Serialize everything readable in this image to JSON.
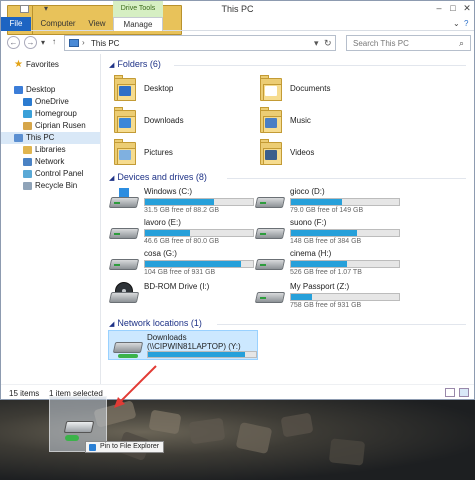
{
  "window": {
    "title": "This PC",
    "tabs": {
      "file": "File",
      "computer": "Computer",
      "view": "View",
      "drive_tools": "Drive Tools",
      "manage": "Manage"
    },
    "address": {
      "separator": "›",
      "path": "This PC"
    },
    "search": {
      "placeholder": "Search This PC"
    }
  },
  "sidebar": {
    "favorites": "Favorites",
    "items": [
      {
        "label": "Desktop",
        "icon": "desktop-icon",
        "color": "#3b7dd8"
      },
      {
        "label": "OneDrive",
        "icon": "onedrive-icon",
        "color": "#2b7bd0"
      },
      {
        "label": "Homegroup",
        "icon": "homegroup-icon",
        "color": "#3aa0d8"
      },
      {
        "label": "Ciprian Rusen",
        "icon": "user-icon",
        "color": "#d6a64a"
      },
      {
        "label": "This PC",
        "icon": "computer-icon",
        "color": "#5b8fd1"
      },
      {
        "label": "Libraries",
        "icon": "library-icon",
        "color": "#e0b54f"
      },
      {
        "label": "Network",
        "icon": "network-icon",
        "color": "#4a82c4"
      },
      {
        "label": "Control Panel",
        "icon": "control-panel-icon",
        "color": "#5aa9d6"
      },
      {
        "label": "Recycle Bin",
        "icon": "recycle-bin-icon",
        "color": "#8fa3b8"
      }
    ]
  },
  "groups": {
    "folders": "Folders (6)",
    "devices": "Devices and drives (8)",
    "network": "Network locations (1)"
  },
  "folders": [
    {
      "label": "Desktop",
      "badge_color": "#2f6fc6"
    },
    {
      "label": "Documents",
      "badge_color": "#ffffff"
    },
    {
      "label": "Downloads",
      "badge_color": "#3a86d8"
    },
    {
      "label": "Music",
      "badge_color": "#4b7fc4"
    },
    {
      "label": "Pictures",
      "badge_color": "#7fb0e0"
    },
    {
      "label": "Videos",
      "badge_color": "#3c5f8c"
    }
  ],
  "drives": [
    {
      "name": "Windows (C:)",
      "free": "31.5 GB free of 88.2 GB",
      "used_fraction": 0.64,
      "kind": "system"
    },
    {
      "name": "gioco (D:)",
      "free": "79.0 GB free of 149 GB",
      "used_fraction": 0.47,
      "kind": "hdd"
    },
    {
      "name": "lavoro (E:)",
      "free": "46.6 GB free of 80.0 GB",
      "used_fraction": 0.42,
      "kind": "hdd"
    },
    {
      "name": "suono (F:)",
      "free": "148 GB free of 384 GB",
      "used_fraction": 0.61,
      "kind": "hdd"
    },
    {
      "name": "cosa (G:)",
      "free": "104 GB free of 931 GB",
      "used_fraction": 0.89,
      "kind": "hdd"
    },
    {
      "name": "cinema (H:)",
      "free": "526 GB free of 1.07 TB",
      "used_fraction": 0.52,
      "kind": "hdd"
    },
    {
      "name": "BD-ROM Drive (I:)",
      "free": "",
      "used_fraction": null,
      "kind": "optical"
    },
    {
      "name": "My Passport (Z:)",
      "free": "758 GB free of 931 GB",
      "used_fraction": 0.19,
      "kind": "hdd"
    }
  ],
  "network_location": {
    "name": "Downloads (\\\\CIPWIN81LAPTOP) (Y:)",
    "used_fraction": 0.9
  },
  "status": {
    "items": "15 items",
    "selected": "1 item selected"
  },
  "tooltip": {
    "label": "Pin to File Explorer"
  },
  "colors": {
    "accent": "#1d64c2",
    "drive_bar": "#26a0da",
    "selection": "#cce8ff"
  }
}
